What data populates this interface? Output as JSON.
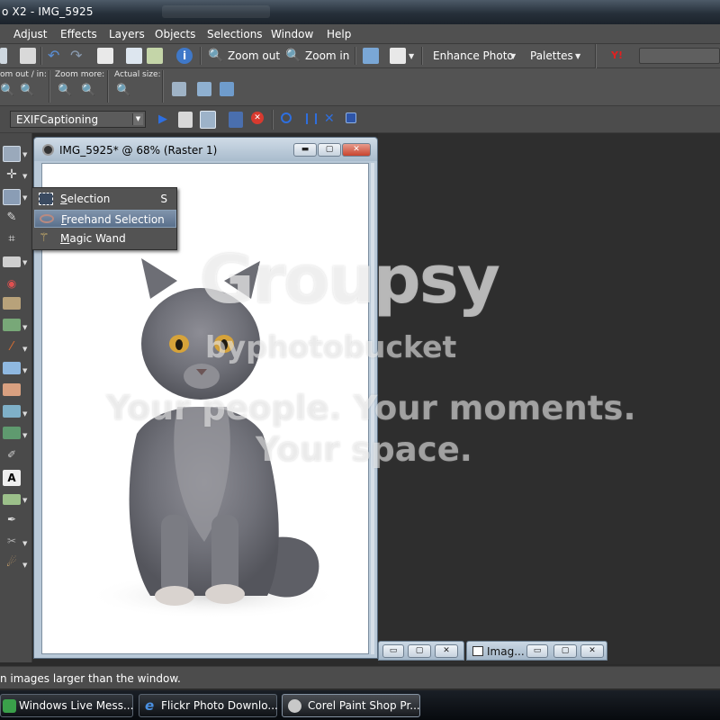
{
  "window": {
    "title": "o X2 - IMG_5925"
  },
  "menubar": {
    "items": [
      "Adjust",
      "Effects",
      "Layers",
      "Objects",
      "Selections",
      "Window",
      "Help"
    ]
  },
  "toolbar": {
    "zoom_out_label": "Zoom out",
    "zoom_in_label": "Zoom in",
    "enhance_photo_label": "Enhance Photo",
    "palettes_label": "Palettes",
    "zoom_out_in_caption": "om out / in:",
    "zoom_more_caption": "Zoom more:",
    "actual_size_caption": "Actual size:"
  },
  "script_toolbar": {
    "selected_script": "EXIFCaptioning"
  },
  "document": {
    "title": "IMG_5925* @  68% (Raster 1)"
  },
  "selection_flyout": {
    "items": [
      {
        "label": "Selection",
        "shortcut": "S",
        "icon": "selection-marquee-icon",
        "selected": false
      },
      {
        "label": "Freehand Selection",
        "shortcut": "",
        "icon": "lasso-icon",
        "selected": true
      },
      {
        "label": "Magic Wand",
        "shortcut": "",
        "icon": "magic-wand-icon",
        "selected": false
      }
    ]
  },
  "minimized_windows": [
    {
      "label": ""
    },
    {
      "label": "Imag..."
    }
  ],
  "statusbar": {
    "text": "n images larger than the window."
  },
  "taskbar": {
    "items": [
      {
        "label": "Windows Live Mess...",
        "active": false
      },
      {
        "label": "Flickr Photo Downlo...",
        "active": false
      },
      {
        "label": "Corel Paint Shop Pr...",
        "active": true
      }
    ]
  },
  "watermark": {
    "brand": "Groupsy",
    "sub": "byphotobucket",
    "line1": "Your people. Your moments.",
    "line2": "Your space."
  },
  "colors": {
    "ui_gray": "#535353",
    "workspace": "#2e2e2e",
    "selection_highlight": "#6a809c",
    "doc_frame": "#b9c9d8"
  }
}
